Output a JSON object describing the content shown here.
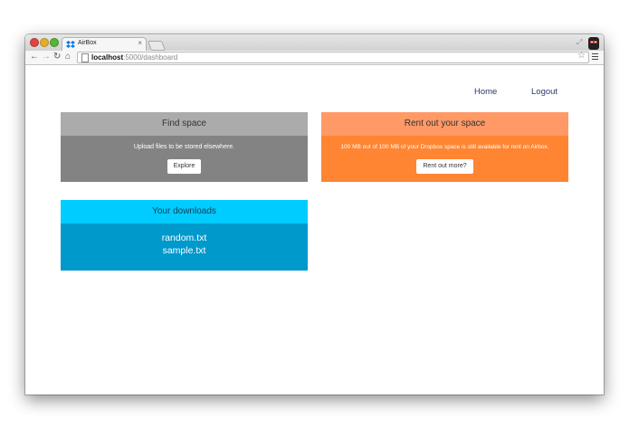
{
  "browser": {
    "tab_title": "AirBox",
    "tab_close": "×",
    "url_host": "localhost",
    "url_rest": ":5000/dashboard"
  },
  "nav": {
    "home": "Home",
    "logout": "Logout"
  },
  "find_space": {
    "title": "Find space",
    "description": "Upload files to be stored elsewhere.",
    "button": "Explore"
  },
  "rent_space": {
    "title": "Rent out your space",
    "description": "100 MB out of 100 MB of your Dropbox space is still available for rent on Airbox.",
    "button": "Rent out more?"
  },
  "downloads": {
    "title": "Your downloads",
    "files": [
      "random.txt",
      "sample.txt"
    ]
  },
  "colors": {
    "find_header": "#ababab",
    "find_body": "#838383",
    "rent_header": "#ff9966",
    "rent_body": "#ff8533",
    "downloads_header": "#00ccff",
    "downloads_body": "#0099cc"
  }
}
